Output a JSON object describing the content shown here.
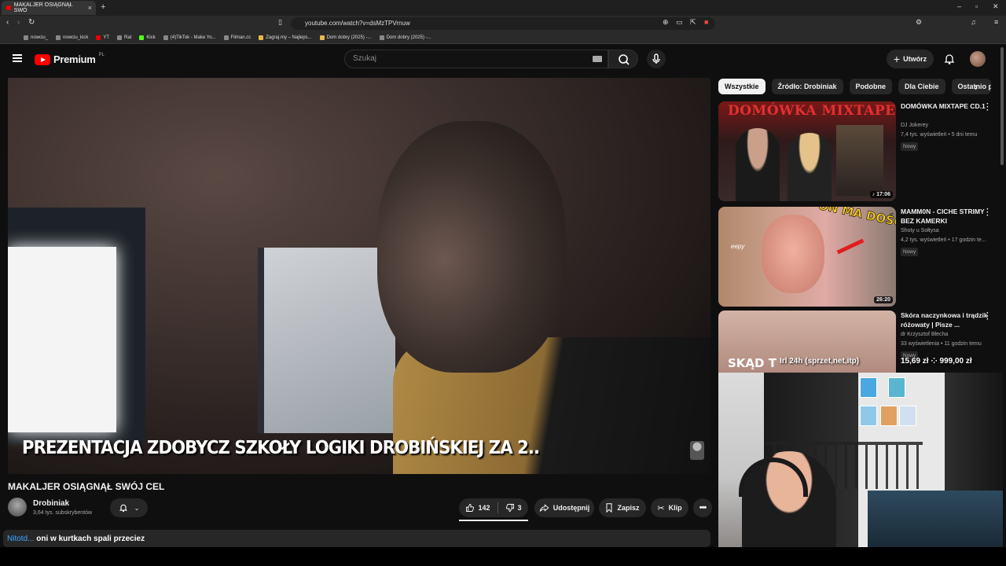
{
  "browser": {
    "tab_title": "MAKALJER OSIĄGNĄŁ SWÓ",
    "url": "youtube.com/watch?v=dsMzTPVrnuw",
    "bookmarks": [
      "nowciu_",
      "nowciu_kick",
      "YT",
      "Rat",
      "Kick",
      "(4)TikTok - Make Yo...",
      "Filman.cc",
      "Zagraj.my – Najleps...",
      "Dom dobry (2025) -...",
      "Dom dobry (2025) -..."
    ]
  },
  "header": {
    "logo_text": "Premium",
    "logo_region": "PL",
    "search_placeholder": "Szukaj",
    "create_label": "Utwórz"
  },
  "video": {
    "caption": "PREZENTACJA ZDOBYCZ SZKOŁY LOGIKI DROBIŃSKIEJ ZA 2..",
    "title": "MAKALJER OSIĄGNĄŁ SWÓJ CEL",
    "channel": "Drobiniak",
    "subscribers": "3,64 tys. subskrybentów",
    "likes": "142",
    "dislikes": "3",
    "share_label": "Udostępnij",
    "save_label": "Zapisz",
    "clip_label": "Klip"
  },
  "comment": {
    "user": "Nitotd...",
    "text": "oni w kurtkach spali przeciez"
  },
  "chips": [
    "Wszystkie",
    "Źródło: Drobiniak",
    "Podobne",
    "Dla Ciebie",
    "Ostatnio pr"
  ],
  "recommendations": [
    {
      "thumb_text": "DOMÓWKA MIXTAPE",
      "duration": "17:06",
      "title": "DOMÓWKA MIXTAPE CD.1",
      "channel": "DJ Jokerey",
      "meta": "7,4 tys. wyświetleń • 5 dni temu",
      "badge": "Nowy"
    },
    {
      "thumb_text": "ON MA DOŚĆ??",
      "thumb_sub": "eepy",
      "duration": "26:20",
      "title": "MAMM0N - CICHE STRIMY BEZ KAMERKI",
      "channel": "Shoty u Sołtysa",
      "meta": "4,2 tys. wyświetleń • 17 godzin te...",
      "badge": "Nowy"
    },
    {
      "thumb_text": "SKĄD T",
      "title": "Skóra naczynkowa i trądzik różowaty | Pisze ...",
      "channel": "dr Krzysztof Błecha",
      "meta": "33 wyświetlenia • 11 godzin temu",
      "badge": "Nowy"
    }
  ],
  "overlay": {
    "left_text": "Irl 24h (sprzet,net,itp)",
    "right_text": "15,69 zł  ⁘  999,00 zł"
  }
}
